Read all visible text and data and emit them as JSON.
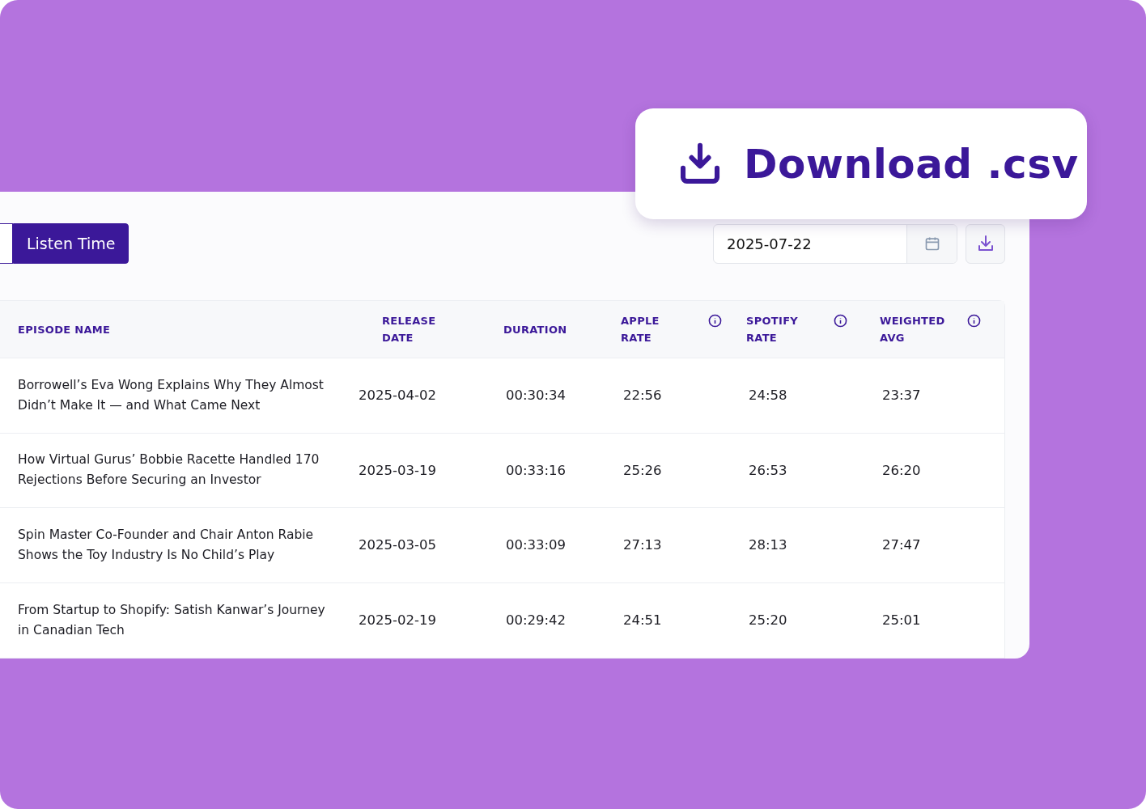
{
  "callout": {
    "label": "Download .csv"
  },
  "tabs": [
    {
      "label": "Listen Time",
      "selected": true
    }
  ],
  "date_field": {
    "value": "2025-07-22"
  },
  "table": {
    "columns": [
      {
        "label": "EPISODE NAME",
        "kind": "plain"
      },
      {
        "label": "RELEASE DATE",
        "kind": "plain"
      },
      {
        "label": "DURATION",
        "kind": "plain"
      },
      {
        "label": "APPLE RATE",
        "kind": "info"
      },
      {
        "label": "SPOTIFY RATE",
        "kind": "info"
      },
      {
        "label": "WEIGHTED AVG",
        "kind": "info"
      }
    ],
    "rows": [
      {
        "cells": [
          "Borrowell’s Eva Wong Explains Why They Almost Didn’t Make It — and What Came Next",
          "2025-04-02",
          "00:30:34",
          "22:56",
          "24:58",
          "23:37"
        ]
      },
      {
        "cells": [
          "How Virtual Gurus’ Bobbie Racette Handled 170 Rejections Before Securing an Investor",
          "2025-03-19",
          "00:33:16",
          "25:26",
          "26:53",
          "26:20"
        ]
      },
      {
        "cells": [
          "Spin Master Co-Founder and Chair Anton Rabie Shows the Toy Industry Is No Child’s Play",
          "2025-03-05",
          "00:33:09",
          "27:13",
          "28:13",
          "27:47"
        ]
      },
      {
        "cells": [
          "From Startup to Shopify: Satish Kanwar’s Journey in Canadian Tech",
          "2025-02-19",
          "00:29:42",
          "24:51",
          "25:20",
          "25:01"
        ]
      }
    ]
  }
}
